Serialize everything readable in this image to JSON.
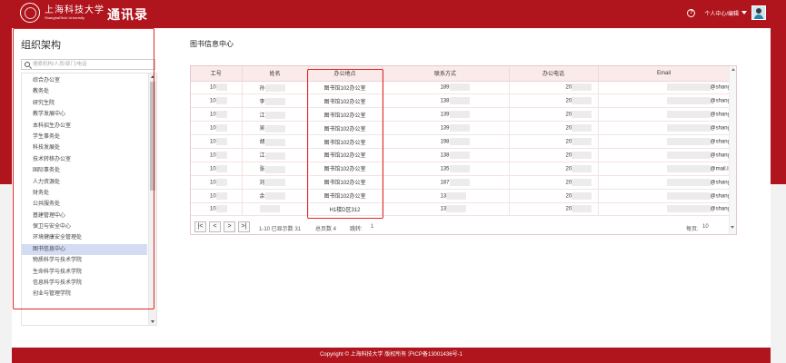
{
  "header": {
    "university_cn": "上海科技大学",
    "university_en": "ShanghaiTech University",
    "app_title": "通讯录",
    "help_icon": "?",
    "user_label": "个人中心/编辑",
    "caret_icon": "chevron-down-icon",
    "avatar_icon": "user-avatar-icon"
  },
  "sidebar": {
    "title": "组织架构",
    "search_placeholder": "搜索机构/人员/部门/电话",
    "items": [
      "综合办公室",
      "教务处",
      "研究生院",
      "教学发展中心",
      "本科招生办公室",
      "学生事务处",
      "科技发展处",
      "技术转移办公室",
      "国际事务处",
      "人力资源处",
      "财务处",
      "公共服务处",
      "基建管理中心",
      "保卫与安全中心",
      "环境健康安全管理处",
      "图书信息中心",
      "物质科学与技术学院",
      "生命科学与技术学院",
      "信息科学与技术学院",
      "创业与管理学院"
    ],
    "active_index": 15
  },
  "main": {
    "page_title": "图书信息中心",
    "columns": [
      "工号",
      "姓名",
      "办公地点",
      "联系方式",
      "办公电话",
      "Email"
    ],
    "rows": [
      {
        "id": "10",
        "name": "孙",
        "office": "图书馆102办公室",
        "phone": "189",
        "tel": "20",
        "email": "@shanghaitech.edu.cn"
      },
      {
        "id": "10",
        "name": "李",
        "office": "图书馆102办公室",
        "phone": "138",
        "tel": "20",
        "email": "@shanghaitech.edu.cn"
      },
      {
        "id": "10",
        "name": "江",
        "office": "图书馆102办公室",
        "phone": "139",
        "tel": "20",
        "email": "@shanghaitech.edu.cn"
      },
      {
        "id": "10",
        "name": "吴",
        "office": "图书馆102办公室",
        "phone": "139",
        "tel": "20",
        "email": "@shanghaitech.edu.cn"
      },
      {
        "id": "10",
        "name": "胡",
        "office": "图书馆102办公室",
        "phone": "198",
        "tel": "20",
        "email": "@shanghaitech.edu.cn"
      },
      {
        "id": "10",
        "name": "江",
        "office": "图书馆102办公室",
        "phone": "138",
        "tel": "20",
        "email": "@shanghaitech.edu.cn"
      },
      {
        "id": "10",
        "name": "张",
        "office": "图书馆102办公室",
        "phone": "135",
        "tel": "20",
        "email": "@mail.las.ac.cn"
      },
      {
        "id": "10",
        "name": "刘",
        "office": "图书馆102办公室",
        "phone": "187",
        "tel": "20",
        "email": "@shanghaitech.edu.cn"
      },
      {
        "id": "10",
        "name": "余",
        "office": "图书馆102办公室",
        "phone": "13",
        "tel": "20",
        "email": "@shanghaitech.edu.cn"
      },
      {
        "id": "10",
        "name": "",
        "office": "H1楼D区312",
        "phone": "13",
        "tel": "20",
        "email": "@shanghaitech.edu.cn"
      }
    ],
    "pager": {
      "first": "|<",
      "prev": "<",
      "next": ">",
      "last": ">|",
      "range": "1-10 已显示数 31",
      "total_pages": "总页数 4",
      "goto_label": "跳转:",
      "goto_value": "1",
      "per_page_label": "每页:",
      "per_page_value": "10"
    }
  },
  "footer": {
    "copyright": "Copyright © 上海科技大学 版权所有 沪ICP备13001436号-1"
  },
  "colors": {
    "brand_red": "#b0141c",
    "highlight_red": "#e32626",
    "active_item": "#d3dcf2"
  }
}
